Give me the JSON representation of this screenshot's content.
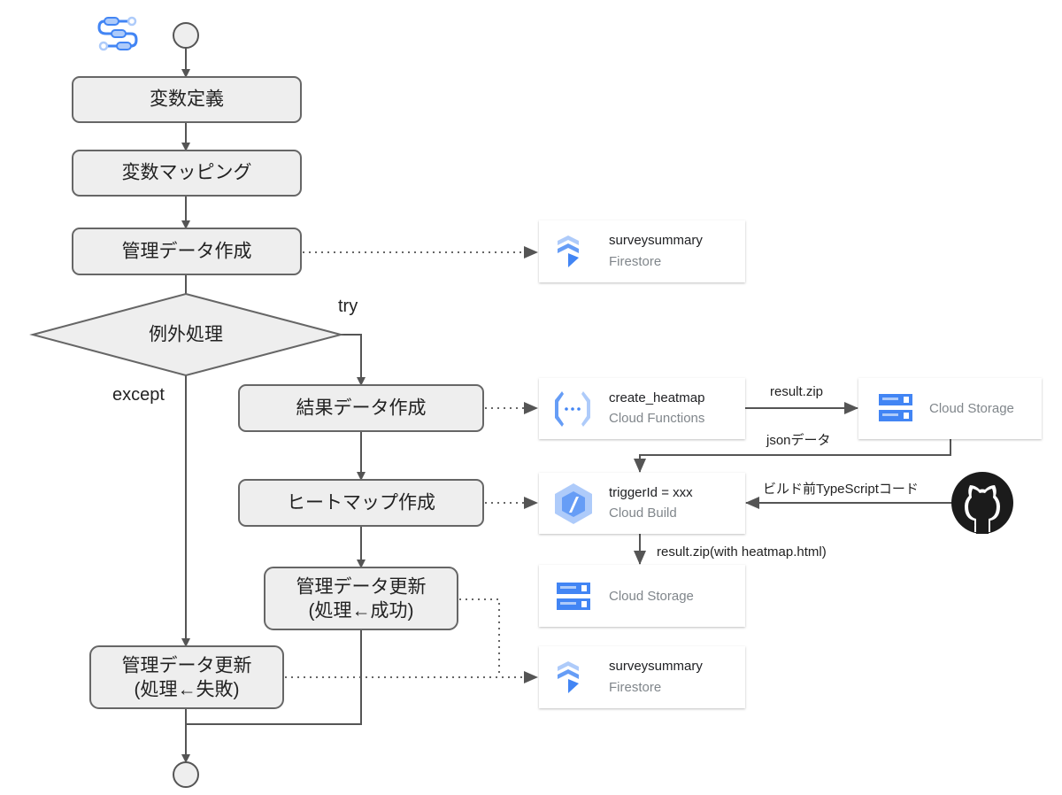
{
  "flow": {
    "define_vars": "変数定義",
    "map_vars": "変数マッピング",
    "create_admin_data": "管理データ作成",
    "exception_handling": "例外処理",
    "try_label": "try",
    "except_label": "except",
    "create_result_data": "結果データ作成",
    "create_heatmap": "ヒートマップ作成",
    "update_success_line1": "管理データ更新",
    "update_success_line2": "(処理←成功)",
    "update_fail_line1": "管理データ更新",
    "update_fail_line2": "(処理←失敗)"
  },
  "services": [
    {
      "title": "surveysummary",
      "subtitle": "Firestore",
      "icon": "firestore-icon"
    },
    {
      "title": "create_heatmap",
      "subtitle": "Cloud Functions",
      "icon": "cloud-functions-icon"
    },
    {
      "title": "",
      "subtitle": "Cloud Storage",
      "icon": "cloud-storage-icon"
    },
    {
      "title": "triggerId = xxx",
      "subtitle": "Cloud Build",
      "icon": "cloud-build-icon"
    },
    {
      "title": "",
      "subtitle": "Cloud Storage",
      "icon": "cloud-storage-icon"
    },
    {
      "title": "surveysummary",
      "subtitle": "Firestore",
      "icon": "firestore-icon"
    }
  ],
  "edges": {
    "result_zip": "result.zip",
    "json_data": "jsonデータ",
    "prebuild_ts": "ビルド前TypeScriptコード",
    "result_zip_html": "result.zip(with heatmap.html)"
  },
  "colors": {
    "google_blue": "#4285f4",
    "google_light_blue": "#aecbfa",
    "node_fill": "#eeeeee"
  }
}
